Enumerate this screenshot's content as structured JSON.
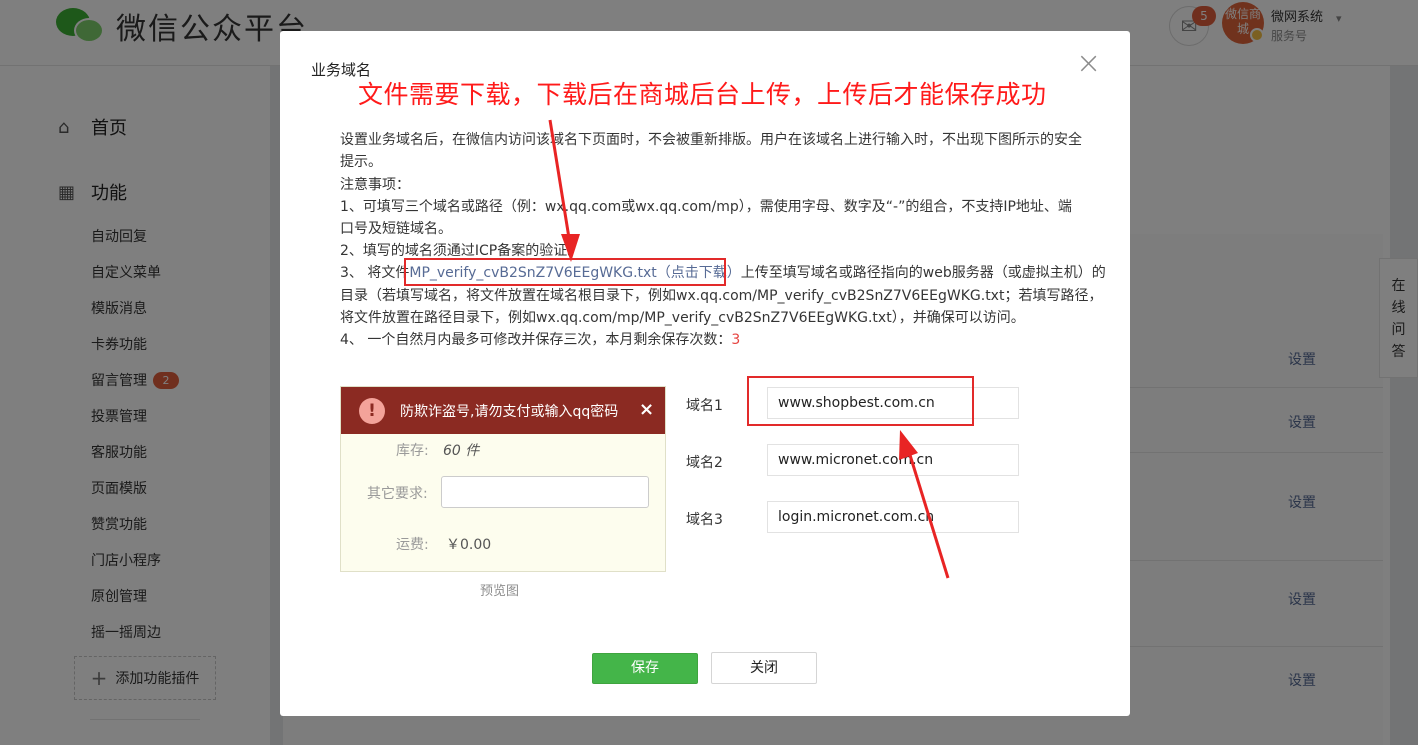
{
  "header": {
    "brand": "微信公众平台",
    "mail_count": "5",
    "avatar_text": "微信商城",
    "account_name": "微网系统",
    "account_type": "服务号",
    "caret": "▾"
  },
  "sidebar": {
    "home": "首页",
    "func": "功能",
    "items": [
      {
        "label": "自动回复"
      },
      {
        "label": "自定义菜单"
      },
      {
        "label": "模版消息"
      },
      {
        "label": "卡券功能"
      },
      {
        "label": "留言管理",
        "badge": "2"
      },
      {
        "label": "投票管理"
      },
      {
        "label": "客服功能"
      },
      {
        "label": "页面模版"
      },
      {
        "label": "赞赏功能"
      },
      {
        "label": "门店小程序"
      },
      {
        "label": "原创管理"
      },
      {
        "label": "摇一摇周边"
      }
    ],
    "add_plugin": "添加功能插件"
  },
  "main": {
    "settings_label": "设置",
    "online_help": "在线问答"
  },
  "dialog": {
    "title": "业务域名",
    "close_symbol": "×",
    "annotation": "文件需要下载，下载后在商城后台上传，上传后才能保存成功",
    "desc1a": "设置业务域名后，在微信内访问该域名下页面时，不会被重新排版。用户在该域名上进行输入时，不出现下图所示的安全",
    "desc1b": "提示。",
    "notes_title": "注意事项：",
    "note1a": "1、可填写三个域名或路径（例：wx.qq.com或wx.qq.com/mp），需使用字母、数字及“-”的组合，不支持IP地址、端",
    "note1b": "口号及短链域名。",
    "note2": "2、填写的域名须通过ICP备案的验证。",
    "note3_prefix": "3、 将文件",
    "note3_link": "MP_verify_cvB2SnZ7V6EEgWKG.txt（点击下载）",
    "note3_suffix": "上传至填写域名或路径指向的web服务器（或虚拟主机）的",
    "note3b": "目录（若填写域名，将文件放置在域名根目录下，例如wx.qq.com/MP_verify_cvB2SnZ7V6EEgWKG.txt；若填写路径，",
    "note3c": "将文件放置在路径目录下，例如wx.qq.com/mp/MP_verify_cvB2SnZ7V6EEgWKG.txt），并确保可以访问。",
    "note4_prefix": "4、 一个自然月内最多可修改并保存三次，本月剩余保存次数：",
    "note4_count": "3",
    "preview": {
      "warning": "防欺诈盗号,请勿支付或输入qq密码",
      "warning_close": "×",
      "stock_label": "库存:",
      "stock_value": "60 件",
      "other_label": "其它要求:",
      "shipping_label": "运费:",
      "shipping_value": "￥0.00",
      "caption": "预览图"
    },
    "domains": [
      {
        "label": "域名1",
        "value": "www.shopbest.com.cn"
      },
      {
        "label": "域名2",
        "value": "www.micronet.com.cn"
      },
      {
        "label": "域名3",
        "value": "login.micronet.com.cn"
      }
    ],
    "save": "保存",
    "close": "关闭"
  }
}
